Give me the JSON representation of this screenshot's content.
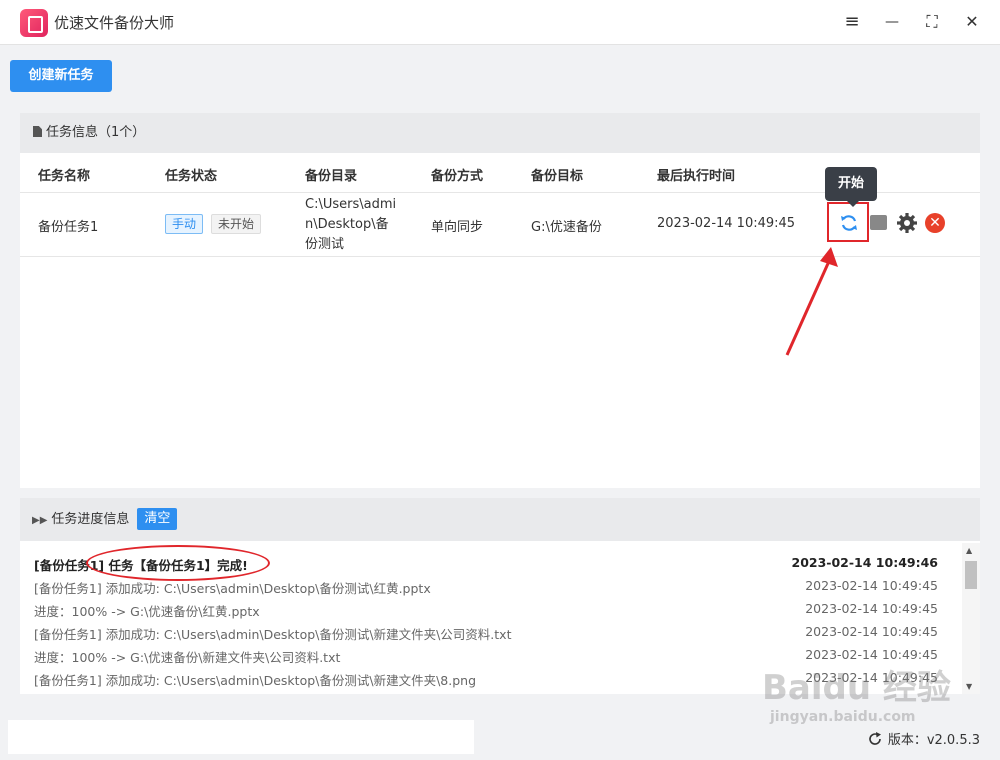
{
  "app": {
    "title": "优速文件备份大师"
  },
  "window_controls": {
    "menu": "≡",
    "minimize": "—",
    "maximize": "⛶",
    "close": "✕"
  },
  "toolbar": {
    "create_label": "创建新任务"
  },
  "task_panel": {
    "header": "任务信息（1个）",
    "columns": [
      "任务名称",
      "任务状态",
      "备份目录",
      "备份方式",
      "备份目标",
      "最后执行时间"
    ],
    "rows": [
      {
        "name": "备份任务1",
        "mode_tag": "手动",
        "status_tag": "未开始",
        "source_line1": "C:\\Users\\admi",
        "source_line2": "n\\Desktop\\备",
        "source_line3": "份测试",
        "method": "单向同步",
        "target": "G:\\优速备份",
        "last_run": "2023-02-14 10:49:45"
      }
    ],
    "tooltip": "开始"
  },
  "progress_panel": {
    "header": "任务进度信息",
    "clear_label": "清空",
    "logs": [
      {
        "msg": "[备份任务1] 任务【备份任务1】完成!",
        "time": "2023-02-14 10:49:46",
        "bold": true
      },
      {
        "msg": "[备份任务1] 添加成功:   C:\\Users\\admin\\Desktop\\备份测试\\红黄.pptx",
        "time": "2023-02-14 10:49:45"
      },
      {
        "msg": "进度：100% -> G:\\优速备份\\红黄.pptx",
        "time": "2023-02-14 10:49:45"
      },
      {
        "msg": "[备份任务1] 添加成功:   C:\\Users\\admin\\Desktop\\备份测试\\新建文件夹\\公司资料.txt",
        "time": "2023-02-14 10:49:45"
      },
      {
        "msg": "进度：100% -> G:\\优速备份\\新建文件夹\\公司资料.txt",
        "time": "2023-02-14 10:49:45"
      },
      {
        "msg": "[备份任务1] 添加成功:   C:\\Users\\admin\\Desktop\\备份测试\\新建文件夹\\8.png",
        "time": "2023-02-14 10:49:45"
      }
    ]
  },
  "status_bar": {
    "version": "版本：v2.0.5.3"
  },
  "watermark": {
    "line1": "Baidu 经验",
    "line2": "jingyan.baidu.com"
  },
  "colors": {
    "accent": "#2e8ff0",
    "annotation_red": "#e0262b",
    "delete_red": "#e8412a"
  }
}
